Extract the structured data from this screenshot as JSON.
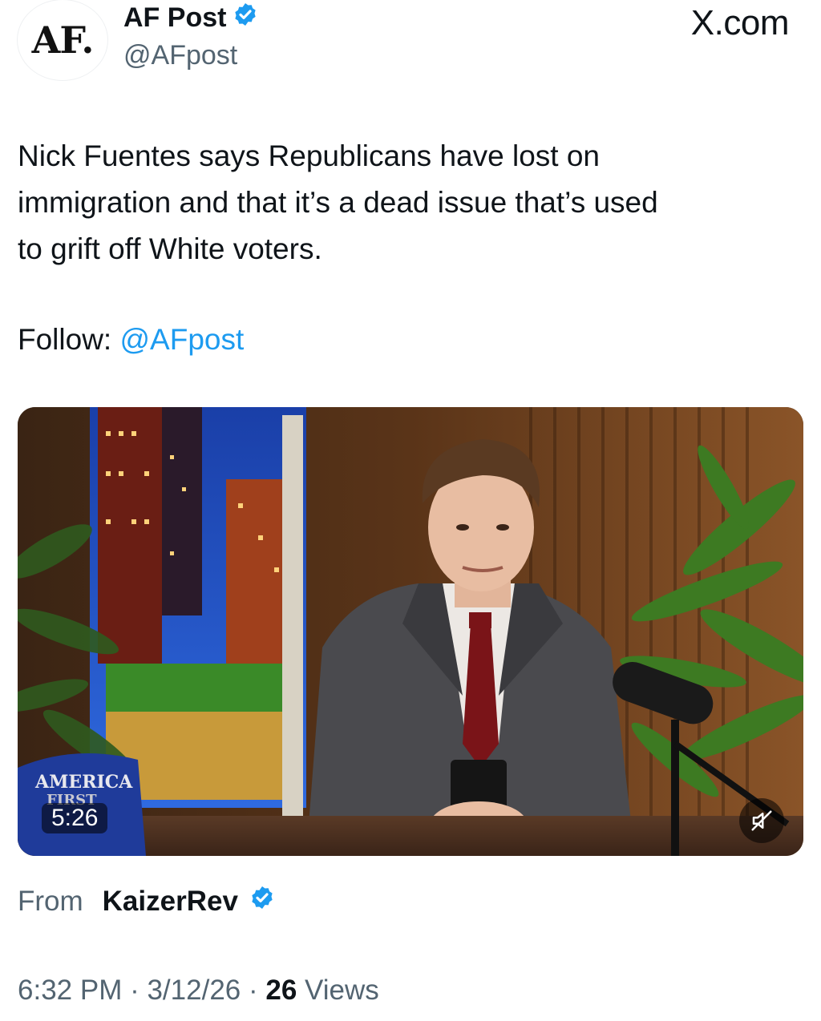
{
  "header": {
    "avatar_text": "AF.",
    "display_name": "AF Post",
    "handle": "@AFpost",
    "site": "X.com",
    "verified_icon": "verified-badge-icon"
  },
  "tweet": {
    "text": "Nick Fuentes says Republicans have lost on\nimmigration and that it’s a dead issue that’s used\nto grift off White voters.",
    "follow_label": "Follow: ",
    "follow_handle": "@AFpost"
  },
  "media": {
    "duration": "5:26",
    "hat_text_line1": "AMERICA",
    "hat_text_line2": "FIRST",
    "mute_icon": "speaker-muted-icon"
  },
  "source": {
    "from_label": "From",
    "from_name": "KaizerRev"
  },
  "meta": {
    "time": "6:32 PM",
    "separator": " · ",
    "date": "3/12/26",
    "views_count": "26",
    "views_label": " Views"
  },
  "colors": {
    "accent": "#1d9bf0",
    "text": "#0f1419",
    "secondary": "#536471"
  }
}
